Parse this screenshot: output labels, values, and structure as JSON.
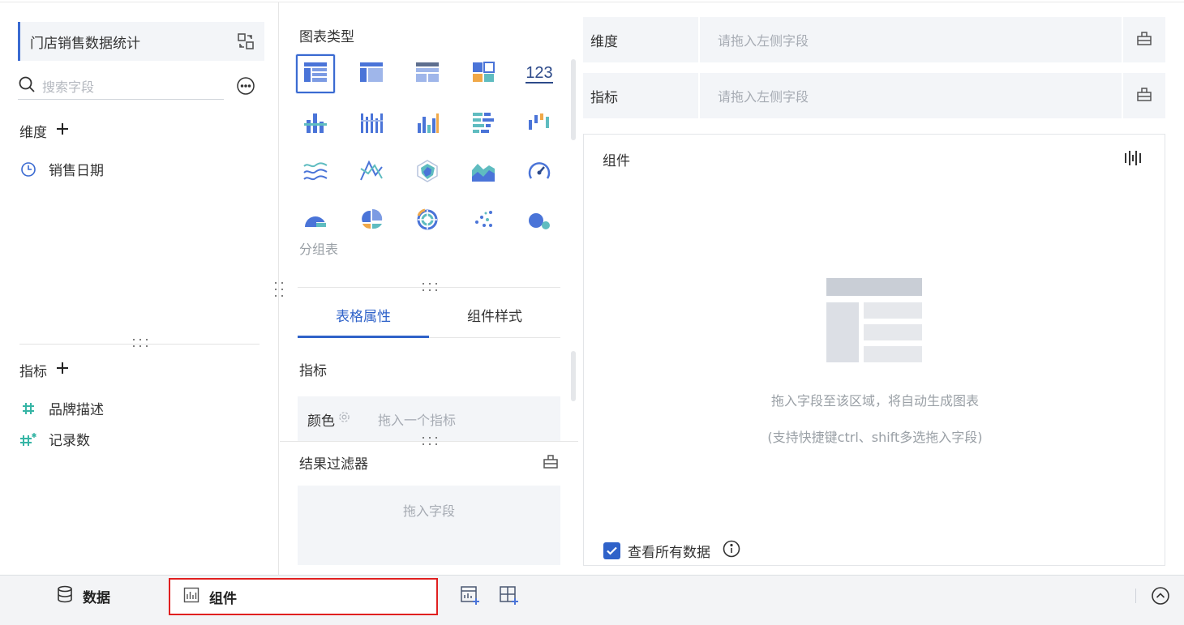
{
  "left_panel": {
    "dataset_name": "门店销售数据统计",
    "search_placeholder": "搜索字段",
    "dimension_header": "维度",
    "dimensions": [
      {
        "label": "销售日期",
        "icon": "clock-icon"
      }
    ],
    "metric_header": "指标",
    "metrics": [
      {
        "label": "品牌描述",
        "icon": "hash-icon"
      },
      {
        "label": "记录数",
        "icon": "hash-star-icon"
      }
    ]
  },
  "middle_panel": {
    "chart_type_title": "图表类型",
    "chart_types": [
      {
        "name": "grouped-table",
        "icon": "group-table-icon"
      },
      {
        "name": "detail-table",
        "icon": "detail-table-icon"
      },
      {
        "name": "cross-table",
        "icon": "cross-table-icon"
      },
      {
        "name": "kpi-card",
        "icon": "kpi-icon"
      },
      {
        "name": "number",
        "icon": "number-icon",
        "text": "123"
      },
      {
        "name": "bar",
        "icon": "bar-icon"
      },
      {
        "name": "multi-bar",
        "icon": "multi-bar-icon"
      },
      {
        "name": "column",
        "icon": "column-icon"
      },
      {
        "name": "horizontal-bar",
        "icon": "hbar-icon"
      },
      {
        "name": "waterfall",
        "icon": "waterfall-icon"
      },
      {
        "name": "line",
        "icon": "line-icon"
      },
      {
        "name": "cross-line",
        "icon": "cross-line-icon"
      },
      {
        "name": "radar",
        "icon": "radar-icon"
      },
      {
        "name": "area",
        "icon": "area-icon"
      },
      {
        "name": "gauge",
        "icon": "gauge-icon"
      },
      {
        "name": "rose",
        "icon": "rose-icon"
      },
      {
        "name": "pie",
        "icon": "pie-icon"
      },
      {
        "name": "sunburst",
        "icon": "sunburst-icon"
      },
      {
        "name": "scatter",
        "icon": "scatter-icon"
      },
      {
        "name": "bubble",
        "icon": "bubble-icon"
      }
    ],
    "selected_chart_label": "分组表",
    "tabs": [
      {
        "label": "表格属性",
        "active": true
      },
      {
        "label": "组件样式",
        "active": false
      }
    ],
    "metric_section_title": "指标",
    "color_label": "颜色",
    "color_hint": "拖入一个指标",
    "filter_title": "结果过滤器",
    "filter_hint": "拖入字段"
  },
  "right_panel": {
    "dimension_zone": {
      "label": "维度",
      "placeholder": "请拖入左侧字段"
    },
    "metric_zone": {
      "label": "指标",
      "placeholder": "请拖入左侧字段"
    },
    "component_title": "组件",
    "empty_text": "拖入字段至该区域，将自动生成图表",
    "empty_subtext": "(支持快捷键ctrl、shift多选拖入字段)",
    "view_all_label": "查看所有数据",
    "view_all_checked": true
  },
  "bottom_bar": {
    "data_tab": "数据",
    "component_tab": "组件"
  },
  "colors": {
    "accent": "#2f62c9",
    "icon_blue": "#4a74d8",
    "icon_teal": "#5fbcc0",
    "icon_orange": "#f0a848",
    "highlight_border": "#e02020"
  }
}
